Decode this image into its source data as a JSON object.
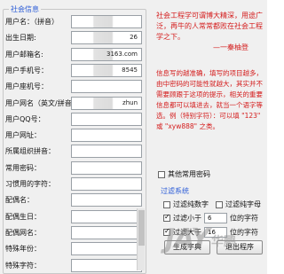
{
  "group_title": "社会信息",
  "fields": [
    {
      "label": "用户名：（拼音）",
      "value": "",
      "smudge": true
    },
    {
      "label": "出生日期:",
      "value": "26",
      "smudge": true
    },
    {
      "label": "用户邮箱名:",
      "value": "3163.com",
      "smudge": true
    },
    {
      "label": "用户手机号：",
      "value": "8545",
      "smudge": true
    },
    {
      "label": "用户座机号：",
      "value": "",
      "smudge": false
    },
    {
      "label": "用户网名（英文/拼音）",
      "value": "zhun",
      "smudge": true
    },
    {
      "label": "用户QQ号：",
      "value": "",
      "smudge": false
    },
    {
      "label": "用户网址：",
      "value": "",
      "smudge": false
    },
    {
      "label": "所属组织拼音：",
      "value": "",
      "smudge": false
    },
    {
      "label": "常用密码：",
      "value": "",
      "smudge": false
    },
    {
      "label": "习惯用的字符：",
      "value": "",
      "smudge": false
    },
    {
      "label": "配偶名：",
      "value": "",
      "smudge": false
    },
    {
      "label": "配偶生日：",
      "value": "",
      "smudge": false
    },
    {
      "label": "配偶网名：",
      "value": "",
      "smudge": false
    },
    {
      "label": "特殊年份：",
      "value": "",
      "smudge": false
    },
    {
      "label": "特殊字符：",
      "value": "",
      "smudge": false
    }
  ],
  "note1": "社会工程学可谓博大精深，用途广泛，再牛的人常常都败在社会工程学之下。",
  "note1_sig": "—一秦柚登",
  "note2": "信息写的越准确，填写的项目越多，由中密码的可能性就越大，其实并不需要顾跟于这项的提示，相关的重要信息都可以填进去，就当一个语字等选。例（特别字符）：可以填 \"123\" 或 \"xyw888\" 之类。",
  "check_common": {
    "label": "其他常用密码",
    "checked": false
  },
  "filter": {
    "title": "过滤系统",
    "opt_digits": {
      "label": "过滤纯数字",
      "checked": false
    },
    "opt_letters": {
      "label": "过滤纯字母",
      "checked": false
    },
    "opt_min": {
      "prefix": "过滤小于",
      "value": "6",
      "suffix": "位的字符",
      "checked": true
    },
    "opt_max": {
      "prefix": "过滤大于",
      "value": "16",
      "suffix": "位的字符",
      "checked": true
    }
  },
  "buttons": {
    "generate": "生成字典",
    "exit": "退出程序"
  },
  "watermark": "JAY",
  "watermark2": "华鹏"
}
